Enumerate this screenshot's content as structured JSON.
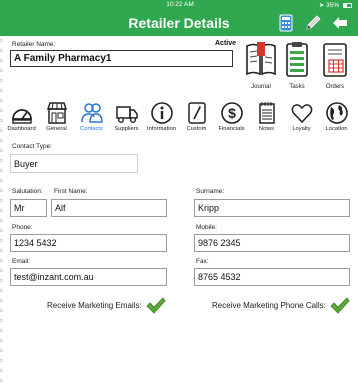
{
  "status": {
    "time": "10:22 AM",
    "battery": "35%"
  },
  "header": {
    "title": "Retailer Details"
  },
  "retailer": {
    "name_label": "Retailer Name:",
    "name_value": "A Family Pharmacy1",
    "status": "Active"
  },
  "tools": [
    {
      "label": "Journal",
      "icon": "journal-icon"
    },
    {
      "label": "Tasks",
      "icon": "tasks-icon"
    },
    {
      "label": "Orders",
      "icon": "orders-icon"
    }
  ],
  "tabs": [
    {
      "label": "Dashboard",
      "icon": "dashboard-icon"
    },
    {
      "label": "General",
      "icon": "storefront-icon"
    },
    {
      "label": "Contacts",
      "icon": "contacts-icon",
      "selected": true
    },
    {
      "label": "Suppliers",
      "icon": "truck-icon"
    },
    {
      "label": "Information",
      "icon": "info-icon"
    },
    {
      "label": "Custom",
      "icon": "custom-icon"
    },
    {
      "label": "Financials",
      "icon": "dollar-icon"
    },
    {
      "label": "Notes",
      "icon": "notes-icon"
    },
    {
      "label": "Loyalty",
      "icon": "heart-icon"
    },
    {
      "label": "Location",
      "icon": "globe-icon"
    }
  ],
  "form": {
    "contact_type_label": "Contact Type:",
    "contact_type_value": "Buyer",
    "salutation_label": "Salutation:",
    "salutation_value": "Mr",
    "first_name_label": "First Name:",
    "first_name_value": "Alf",
    "surname_label": "Surname:",
    "surname_value": "Kripp",
    "phone_label": "Phone:",
    "phone_value": "1234 5432",
    "mobile_label": "Mobile:",
    "mobile_value": "9876 2345",
    "email_label": "Email:",
    "email_value": "test@inzant.com.au",
    "fax_label": "Fax:",
    "fax_value": "8765 4532",
    "marketing_emails_label": "Receive Marketing Emails:",
    "marketing_emails_checked": true,
    "marketing_calls_label": "Receive Marketing Phone Calls:",
    "marketing_calls_checked": true
  },
  "colors": {
    "header_green": "#2fa84f",
    "check_green": "#5aa83a",
    "selected_tab": "#2a76d2"
  }
}
